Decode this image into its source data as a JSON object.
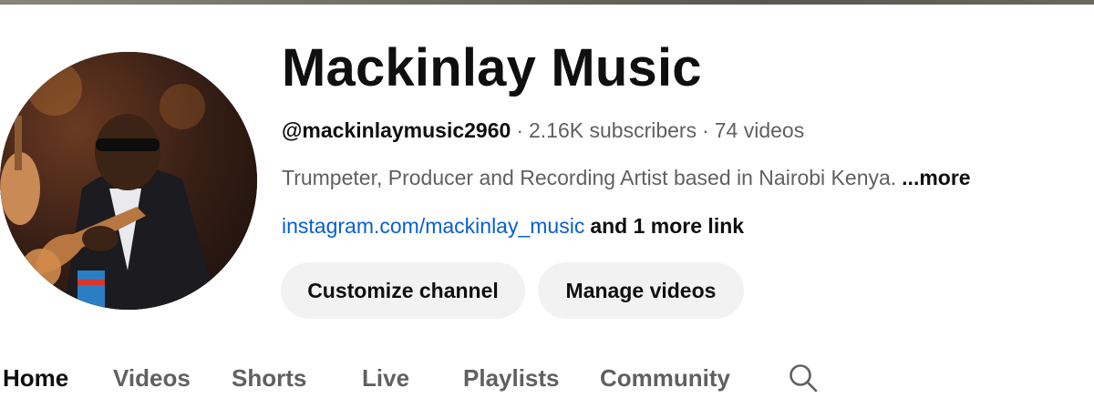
{
  "channel": {
    "name": "Mackinlay Music",
    "handle": "@mackinlaymusic2960",
    "separator": "·",
    "subscribers": "2.16K subscribers",
    "videos": "74 videos",
    "description": "Trumpeter, Producer and Recording Artist based in Nairobi Kenya.",
    "description_more": "...more",
    "link": "instagram.com/mackinlay_music",
    "more_links": "and 1 more link",
    "avatar_icon": "channel-avatar-photo"
  },
  "actions": {
    "customize_label": "Customize channel",
    "manage_label": "Manage videos"
  },
  "tabs": [
    {
      "label": "Home",
      "active": true
    },
    {
      "label": "Videos",
      "active": false
    },
    {
      "label": "Shorts",
      "active": false
    },
    {
      "label": "Live",
      "active": false
    },
    {
      "label": "Playlists",
      "active": false
    },
    {
      "label": "Community",
      "active": false
    }
  ],
  "search_icon": "search-icon",
  "colors": {
    "link": "#065fd4",
    "button_bg": "#f2f2f2",
    "secondary_text": "#606060",
    "primary_text": "#0f0f0f"
  }
}
